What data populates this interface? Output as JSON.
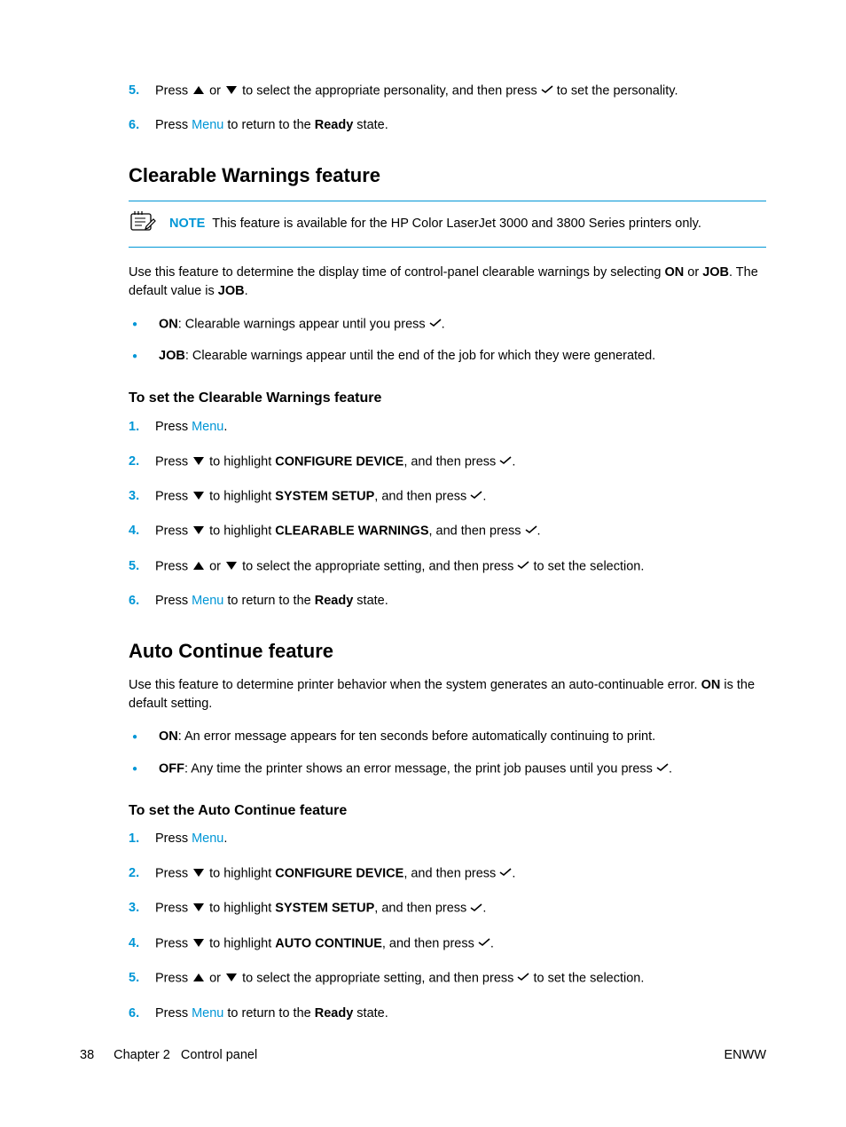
{
  "topSteps": {
    "step5": {
      "num": "5.",
      "press": "Press ",
      "or": " or ",
      "mid": " to select the appropriate personality, and then press ",
      "end": " to set the personality."
    },
    "step6": {
      "num": "6.",
      "press": "Press ",
      "menu": "Menu",
      "mid": " to return to the ",
      "ready": "Ready",
      "end": " state."
    }
  },
  "clearable": {
    "heading": "Clearable Warnings feature",
    "noteLabel": "NOTE",
    "noteText": "This feature is available for the HP Color LaserJet 3000 and 3800 Series printers only.",
    "intro1a": "Use this feature to determine the display time of control-panel clearable warnings by selecting ",
    "intro1on": "ON",
    "intro1or": " or ",
    "intro1job": "JOB",
    "intro1b": ". The default value is ",
    "intro1job2": "JOB",
    "intro1end": ".",
    "bullet1on": "ON",
    "bullet1text": ": Clearable warnings appear until you press ",
    "bullet1end": ".",
    "bullet2job": "JOB",
    "bullet2text": ": Clearable warnings appear until the end of the job for which they were generated.",
    "subhead": "To set the Clearable Warnings feature",
    "steps": {
      "s1": {
        "num": "1.",
        "press": "Press ",
        "menu": "Menu",
        "end": "."
      },
      "s2": {
        "num": "2.",
        "press": "Press ",
        "mid": " to highlight ",
        "hl": "CONFIGURE DEVICE",
        "then": ", and then press ",
        "end": "."
      },
      "s3": {
        "num": "3.",
        "press": "Press ",
        "mid": " to highlight ",
        "hl": "SYSTEM SETUP",
        "then": ", and then press ",
        "end": "."
      },
      "s4": {
        "num": "4.",
        "press": "Press ",
        "mid": " to highlight ",
        "hl": "CLEARABLE WARNINGS",
        "then": ", and then press ",
        "end": "."
      },
      "s5": {
        "num": "5.",
        "press": "Press ",
        "or": " or ",
        "mid": " to select the appropriate setting, and then press ",
        "end": " to set the selection."
      },
      "s6": {
        "num": "6.",
        "press": "Press ",
        "menu": "Menu",
        "mid": " to return to the ",
        "ready": "Ready",
        "end": " state."
      }
    }
  },
  "auto": {
    "heading": "Auto Continue feature",
    "intro1": "Use this feature to determine printer behavior when the system generates an auto-continuable error. ",
    "introOn": "ON",
    "intro2": " is the default setting.",
    "bullet1on": "ON",
    "bullet1text": ": An error message appears for ten seconds before automatically continuing to print.",
    "bullet2off": "OFF",
    "bullet2text": ": Any time the printer shows an error message, the print job pauses until you press ",
    "bullet2end": ".",
    "subhead": "To set the Auto Continue feature",
    "steps": {
      "s1": {
        "num": "1.",
        "press": "Press ",
        "menu": "Menu",
        "end": "."
      },
      "s2": {
        "num": "2.",
        "press": "Press ",
        "mid": " to highlight ",
        "hl": "CONFIGURE DEVICE",
        "then": ", and then press ",
        "end": "."
      },
      "s3": {
        "num": "3.",
        "press": "Press ",
        "mid": " to highlight ",
        "hl": "SYSTEM SETUP",
        "then": ", and then press ",
        "end": "."
      },
      "s4": {
        "num": "4.",
        "press": "Press ",
        "mid": " to highlight ",
        "hl": "AUTO CONTINUE",
        "then": ", and then press ",
        "end": "."
      },
      "s5": {
        "num": "5.",
        "press": "Press ",
        "or": " or ",
        "mid": " to select the appropriate setting, and then press ",
        "end": " to set the selection."
      },
      "s6": {
        "num": "6.",
        "press": "Press ",
        "menu": "Menu",
        "mid": " to return to the ",
        "ready": "Ready",
        "end": " state."
      }
    }
  },
  "footer": {
    "page": "38",
    "chapter": "Chapter 2",
    "title": "Control panel",
    "right": "ENWW"
  }
}
